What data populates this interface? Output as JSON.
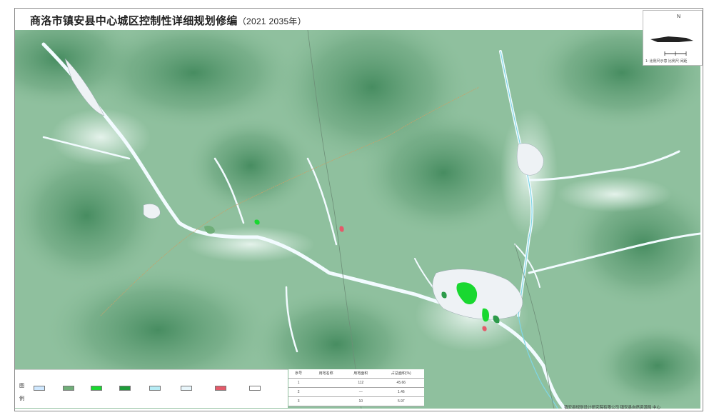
{
  "title": {
    "main": "商洛市镇安县中心城区控制性详细规划修编",
    "years": "（2021  2035年）"
  },
  "compass": {
    "north": "N",
    "caption": "1:  比例尺示意  比例尺  间距"
  },
  "legend": {
    "title_lines": [
      "图",
      "例"
    ],
    "items": [
      {
        "label": "",
        "color": "#cfe8ff"
      },
      {
        "label": "",
        "color": "#6fae78"
      },
      {
        "label": "",
        "color": "#19d830"
      },
      {
        "label": "",
        "color": "#1e9c3a"
      },
      {
        "label": "",
        "color": "#b6ecf5"
      },
      {
        "label": "",
        "color": "#e8f6fb"
      },
      {
        "label": "",
        "color": "#e45a6a"
      },
      {
        "label": "",
        "color": "#ffffff"
      }
    ]
  },
  "stats": {
    "headers": [
      "序号",
      "用地名称",
      "用地面积",
      "占总面积(%)"
    ],
    "rows": [
      [
        "1",
        "",
        "112",
        "45.66"
      ],
      [
        "2",
        "",
        "—",
        "1.46"
      ],
      [
        "3",
        "",
        "10",
        "5.97"
      ]
    ]
  },
  "credit": "镇安县规划设计研究院有限公司  镇安县自然资源局  中心"
}
